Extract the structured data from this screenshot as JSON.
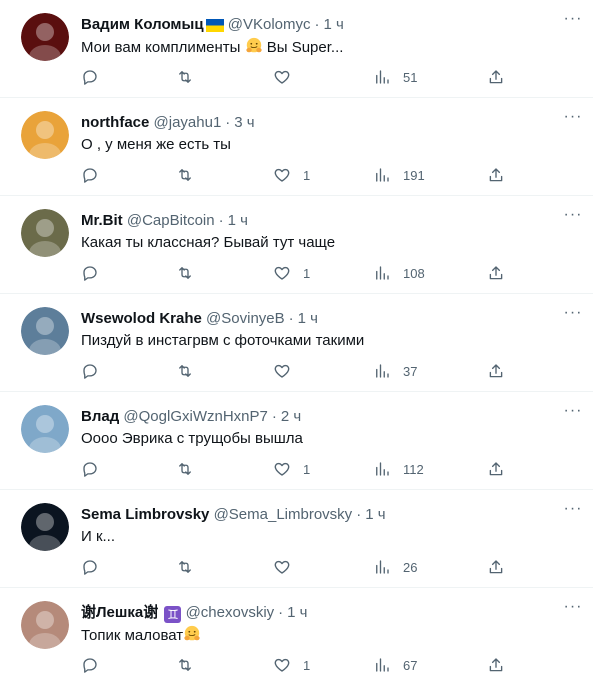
{
  "tweets": [
    {
      "name": "Вадим Коломыц",
      "flag": "ua",
      "handle": "@VKolomyc",
      "time": "1 ч",
      "text": "Мои вам комплименты ",
      "text_after_emoji": " Вы Super...",
      "has_hug": true,
      "likes": "",
      "views": "51",
      "avatar_color": "#5a0f0f"
    },
    {
      "name": "northface",
      "handle": "@jayahu1",
      "time": "3 ч",
      "text": "О , у меня же есть ты",
      "likes": "1",
      "views": "191",
      "avatar_color": "#e9a33a"
    },
    {
      "name": "Mr.Bit",
      "handle": "@CapBitcoin",
      "time": "1 ч",
      "text": "Какая ты классная? Бывай тут чаще",
      "likes": "1",
      "views": "108",
      "avatar_color": "#6b6b4a"
    },
    {
      "name": "Wsewolod Krahe",
      "handle": "@SovinyeB",
      "time": "1 ч",
      "text": "Пиздуй в инстагрвм с фоточками такими",
      "likes": "",
      "views": "37",
      "avatar_color": "#5d7e9a"
    },
    {
      "name": "Влад",
      "handle": "@QoglGxiWznHxnP7",
      "time": "2 ч",
      "text": "Оооо Эврика с трущобы вышла",
      "likes": "1",
      "views": "112",
      "avatar_color": "#7fa8c9"
    },
    {
      "name": "Sema Limbrovsky",
      "handle": "@Sema_Limbrovsky",
      "time": "1 ч",
      "text": "И к...",
      "likes": "",
      "views": "26",
      "avatar_color": "#0b1420"
    },
    {
      "name": "谢Лешка谢",
      "gemini": "♊",
      "handle": "@chexovskiy",
      "time": "1 ч",
      "text": "Топик маловат",
      "has_hug_end": true,
      "likes": "1",
      "views": "67",
      "avatar_color": "#b58a7a"
    }
  ],
  "icons": {
    "reply": "reply-icon",
    "retweet": "retweet-icon",
    "like": "heart-icon",
    "views": "views-icon",
    "share": "share-icon",
    "more": "more-icon"
  },
  "colors": {
    "text": "#0f1419",
    "muted": "#536471",
    "divider": "#eff3f4"
  }
}
